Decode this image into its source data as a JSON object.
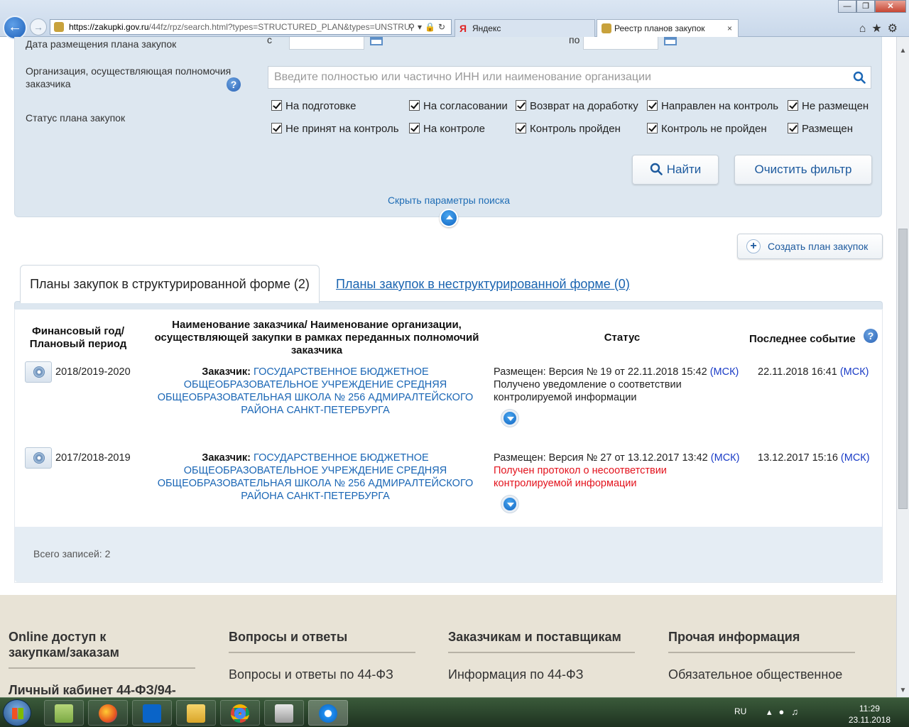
{
  "browser": {
    "url_host": "https://zakupki.gov.ru",
    "url_path": "/44fz/rpz/search.html?types=STRUCTURED_PLAN&types=UNSTRU",
    "tabs": [
      {
        "label": "Яндекс",
        "active": false
      },
      {
        "label": "Реестр планов закупок",
        "active": true
      }
    ],
    "tab_close": "×"
  },
  "filters": {
    "date_label": "Дата размещения плана закупок",
    "date_from_label": "с",
    "date_to_label": "по",
    "org_label_line1": "Организация, осуществляющая полномочия",
    "org_label_line2": "заказчика",
    "org_placeholder": "Введите полностью или частично ИНН или наименование организации",
    "status_label": "Статус плана закупок",
    "statuses": [
      {
        "label": "На подготовке",
        "checked": true
      },
      {
        "label": "На согласовании",
        "checked": true
      },
      {
        "label": "Возврат на доработку",
        "checked": true
      },
      {
        "label": "Направлен на контроль",
        "checked": true
      },
      {
        "label": "Не размещен",
        "checked": true
      },
      {
        "label": "Не принят на контроль",
        "checked": true
      },
      {
        "label": "На контроле",
        "checked": true
      },
      {
        "label": "Контроль пройден",
        "checked": true
      },
      {
        "label": "Контроль не пройден",
        "checked": true
      },
      {
        "label": "Размещен",
        "checked": true
      }
    ],
    "find_button": "Найти",
    "clear_button": "Очистить фильтр",
    "hide_params_link": "Скрыть параметры поиска"
  },
  "create_button": "Создать план закупок",
  "tabs": {
    "structured": "Планы закупок в структурированной форме (2)",
    "unstructured": "Планы закупок в неструктурированной форме (0)"
  },
  "table": {
    "headers": {
      "year_line1": "Финансовый год/",
      "year_line2": "Плановый период",
      "customer_line1": "Наименование заказчика/ Наименование организации,",
      "customer_line2": "осуществляющей закупки в рамках переданных полномочий",
      "customer_line3": "заказчика",
      "status": "Статус",
      "last_event": "Последнее событие"
    },
    "rows": [
      {
        "year": "2018/2019-2020",
        "customer_key": "Заказчик:",
        "customer_line1": "ГОСУДАРСТВЕННОЕ БЮДЖЕТНОЕ",
        "customer_line2": "ОБЩЕОБРАЗОВАТЕЛЬНОЕ УЧРЕЖДЕНИЕ СРЕДНЯЯ",
        "customer_line3": "ОБЩЕОБРАЗОВАТЕЛЬНАЯ ШКОЛА № 256 АДМИРАЛТЕЙСКОГО",
        "customer_line4": "РАЙОНА САНКТ-ПЕТЕРБУРГА",
        "status_main": "Размещен: Версия № 19 от 22.11.2018 15:42",
        "status_tz": "(МСК)",
        "status_note_line1": "Получено уведомление о соответствии",
        "status_note_line2": "контролируемой информации",
        "status_note_color": "#222222",
        "last_event": "22.11.2018 16:41",
        "last_event_tz": "(МСК)"
      },
      {
        "year": "2017/2018-2019",
        "customer_key": "Заказчик:",
        "customer_line1": "ГОСУДАРСТВЕННОЕ БЮДЖЕТНОЕ",
        "customer_line2": "ОБЩЕОБРАЗОВАТЕЛЬНОЕ УЧРЕЖДЕНИЕ СРЕДНЯЯ",
        "customer_line3": "ОБЩЕОБРАЗОВАТЕЛЬНАЯ ШКОЛА № 256 АДМИРАЛТЕЙСКОГО",
        "customer_line4": "РАЙОНА САНКТ-ПЕТЕРБУРГА",
        "status_main": "Размещен: Версия № 27 от 13.12.2017 13:42",
        "status_tz": "(МСК)",
        "status_note_line1": "Получен протокол о несоответствии",
        "status_note_line2": "контролируемой информации",
        "status_note_color": "#e3131d",
        "last_event": "13.12.2017 15:16",
        "last_event_tz": "(МСК)"
      }
    ],
    "total": "Всего записей: 2"
  },
  "footer": {
    "columns": [
      {
        "title_line1": "Online доступ к",
        "title_line2": "закупкам/заказам",
        "link": "Личный кабинет 44-ФЗ/94-"
      },
      {
        "title_line1": "Вопросы и ответы",
        "title_line2": "",
        "link": "Вопросы и ответы по 44-ФЗ"
      },
      {
        "title_line1": "Заказчикам и поставщикам",
        "title_line2": "",
        "link": "Информация по 44-ФЗ"
      },
      {
        "title_line1": "Прочая информация",
        "title_line2": "",
        "link": "Обязательное общественное"
      }
    ]
  },
  "taskbar": {
    "lang": "RU",
    "time": "11:29",
    "date": "23.11.2018"
  },
  "colors": {
    "accent": "#1d5a9e",
    "link": "#1a66b5",
    "panel": "#dde7f0",
    "error": "#e3131d",
    "footer": "#e8e3d6"
  }
}
